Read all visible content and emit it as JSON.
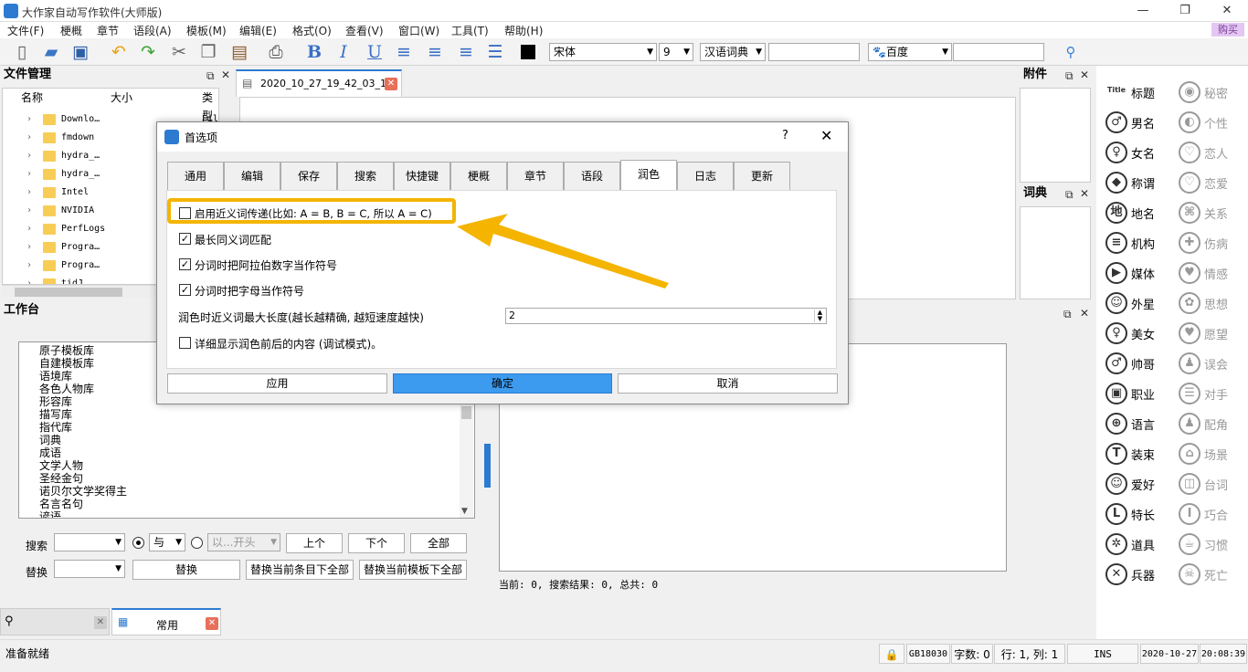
{
  "app": {
    "title": "大作家自动写作软件(大师版)",
    "buy": "购买"
  },
  "window": {
    "min": "—",
    "max": "❐",
    "close": "✕"
  },
  "menu": [
    "文件(F)",
    "梗概",
    "章节",
    "语段(A)",
    "模板(M)",
    "编辑(E)",
    "格式(O)",
    "查看(V)",
    "窗口(W)",
    "工具(T)",
    "帮助(H)"
  ],
  "toolbar": {
    "font": "宋体",
    "size": "9",
    "dict": "汉语词典",
    "search_engine": "百度"
  },
  "file_manager": {
    "title": "文件管理",
    "cols": [
      "名称",
      "大小",
      "类型"
    ],
    "items": [
      "Downlo…",
      "fmdown",
      "hydra_…",
      "hydra_…",
      "Intel",
      "NVIDIA",
      "PerfLogs",
      "Progra…",
      "Progra…",
      "tidJ…"
    ],
    "type_col_value": "Fil"
  },
  "doc_tab": {
    "label": "2020_10_27_19_42_03_1"
  },
  "attach": {
    "title": "附件"
  },
  "dict_panel": {
    "title": "词典"
  },
  "workbench": {
    "title": "工作台",
    "items": [
      "原子模板库",
      "自建模板库",
      "语境库",
      "各色人物库",
      "形容库",
      "描写库",
      "指代库",
      "词典",
      "成语",
      "文学人物",
      "圣经金句",
      "诺贝尔文学奖得主",
      "名言名句",
      "谚语"
    ]
  },
  "search": {
    "label": "搜索",
    "replace_label": "替换",
    "and_option": "与",
    "from_start": "以...开头",
    "prev": "上个",
    "next": "下个",
    "all": "全部",
    "replace": "替换",
    "replace_item": "替换当前条目下全部",
    "replace_tpl": "替换当前模板下全部"
  },
  "result": {
    "text": "当前: 0, 搜索结果: 0, 总共: 0"
  },
  "bottom_tabs": {
    "common": "常用"
  },
  "status": {
    "ready": "准备就绪",
    "encoding": "GB18030",
    "words": "字数: 0",
    "pos": "行: 1, 列: 1",
    "ins": "INS",
    "date": "2020-10-27",
    "time": "20:08:39"
  },
  "sidebar": {
    "left": [
      {
        "icon": "Title",
        "label": "标题"
      },
      {
        "icon": "♂",
        "label": "男名"
      },
      {
        "icon": "♀",
        "label": "女名"
      },
      {
        "icon": "◆",
        "label": "称谓"
      },
      {
        "icon": "地",
        "label": "地名"
      },
      {
        "icon": "≡",
        "label": "机构"
      },
      {
        "icon": "▶",
        "label": "媒体"
      },
      {
        "icon": "☺",
        "label": "外星"
      },
      {
        "icon": "♀",
        "label": "美女"
      },
      {
        "icon": "♂",
        "label": "帅哥"
      },
      {
        "icon": "▣",
        "label": "职业"
      },
      {
        "icon": "⊕",
        "label": "语言"
      },
      {
        "icon": "T",
        "label": "装束"
      },
      {
        "icon": "☺",
        "label": "爱好"
      },
      {
        "icon": "L",
        "label": "特长"
      },
      {
        "icon": "✲",
        "label": "道具"
      },
      {
        "icon": "✕",
        "label": "兵器"
      }
    ],
    "right": [
      {
        "icon": "◉",
        "label": "秘密"
      },
      {
        "icon": "◐",
        "label": "个性"
      },
      {
        "icon": "♡",
        "label": "恋人"
      },
      {
        "icon": "♡",
        "label": "恋爱"
      },
      {
        "icon": "⌘",
        "label": "关系"
      },
      {
        "icon": "✚",
        "label": "伤病"
      },
      {
        "icon": "♥",
        "label": "情感"
      },
      {
        "icon": "✿",
        "label": "思想"
      },
      {
        "icon": "♥",
        "label": "愿望"
      },
      {
        "icon": "♟",
        "label": "误会"
      },
      {
        "icon": "☰",
        "label": "对手"
      },
      {
        "icon": "♟",
        "label": "配角"
      },
      {
        "icon": "⌂",
        "label": "场景"
      },
      {
        "icon": "◫",
        "label": "台词"
      },
      {
        "icon": "I",
        "label": "巧合"
      },
      {
        "icon": "☕",
        "label": "习惯"
      },
      {
        "icon": "☠",
        "label": "死亡"
      }
    ]
  },
  "dialog": {
    "title": "首选项",
    "help": "?",
    "tabs": [
      "通用",
      "编辑",
      "保存",
      "搜索",
      "快捷键",
      "梗概",
      "章节",
      "语段",
      "润色",
      "日志",
      "更新"
    ],
    "active_tab": "润色",
    "options": [
      {
        "label": "启用近义词传递(比如: A = B, B = C, 所以 A = C)",
        "checked": false
      },
      {
        "label": "最长同义词匹配",
        "checked": true
      },
      {
        "label": "分词时把阿拉伯数字当作符号",
        "checked": true
      },
      {
        "label": "分词时把字母当作符号",
        "checked": true
      }
    ],
    "maxlen_label": "润色时近义词最大长度(越长越精确, 越短速度越快)",
    "maxlen_value": "2",
    "verbose_label": "详细显示润色前后的内容 (调试模式)。",
    "verbose_checked": false,
    "apply": "应用",
    "ok": "确定",
    "cancel": "取消"
  },
  "colors": {
    "accent": "#2d7bd1",
    "highlight": "#f4b400",
    "ok_button": "#3c9aef"
  }
}
